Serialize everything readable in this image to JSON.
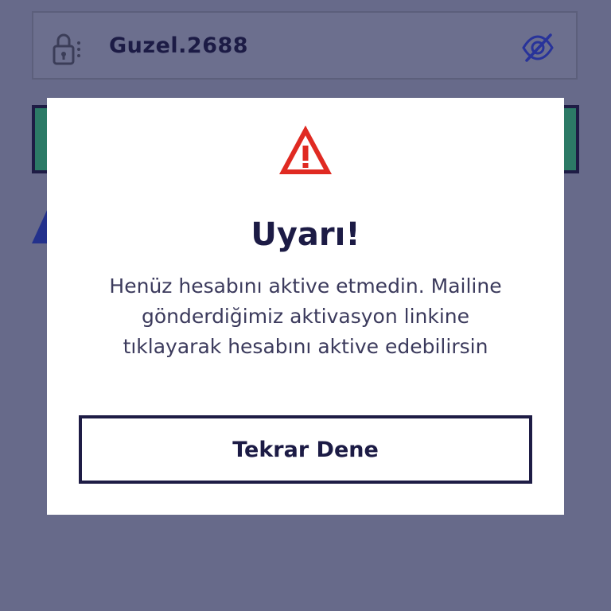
{
  "background": {
    "password_field": {
      "value": "Guzel.2688",
      "leading_icon": "lock-icon",
      "trailing_icon": "eye-off-icon"
    }
  },
  "modal": {
    "icon": "warning-icon",
    "title": "Uyarı!",
    "message": "Henüz hesabını aktive etmedin. Mailine gönderdiğimiz aktivasyon linkine tıklayarak hesabını aktive edebilirsin",
    "retry_label": "Tekrar Dene"
  },
  "colors": {
    "overlay": "#676a8a",
    "text_dark": "#1c1b45",
    "accent_green": "#2c7a66",
    "warning_red": "#e02a22",
    "accent_blue": "#23318c"
  }
}
